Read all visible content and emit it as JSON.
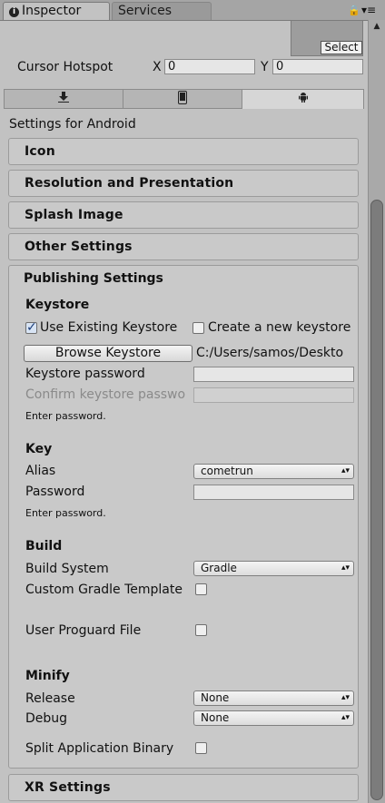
{
  "tabs": {
    "inspector": "Inspector",
    "services": "Services"
  },
  "top": {
    "select_label": "Select",
    "cursor_hotspot_label": "Cursor Hotspot",
    "x_label": "X",
    "x_value": "0",
    "y_label": "Y",
    "y_value": "0"
  },
  "platform_tabs": [
    "download-icon",
    "mobile-icon",
    "android-icon"
  ],
  "settings_for": "Settings for Android",
  "sections": {
    "icon": "Icon",
    "resolution": "Resolution and Presentation",
    "splash": "Splash Image",
    "other": "Other Settings",
    "publishing": "Publishing Settings",
    "xr": "XR Settings"
  },
  "keystore": {
    "heading": "Keystore",
    "use_existing_label": "Use Existing Keystore",
    "use_existing_checked": true,
    "create_new_label": "Create a new keystore",
    "browse_label": "Browse Keystore",
    "path": "C:/Users/samos/Deskto",
    "password_label": "Keystore password",
    "confirm_label": "Confirm keystore passwo",
    "enter_password": "Enter password."
  },
  "key": {
    "heading": "Key",
    "alias_label": "Alias",
    "alias_value": "cometrun",
    "password_label": "Password",
    "enter_password": "Enter password."
  },
  "build": {
    "heading": "Build",
    "system_label": "Build System",
    "system_value": "Gradle",
    "custom_gradle_label": "Custom Gradle Template",
    "proguard_label": "User Proguard File"
  },
  "minify": {
    "heading": "Minify",
    "release_label": "Release",
    "release_value": "None",
    "debug_label": "Debug",
    "debug_value": "None",
    "split_label": "Split Application Binary"
  }
}
